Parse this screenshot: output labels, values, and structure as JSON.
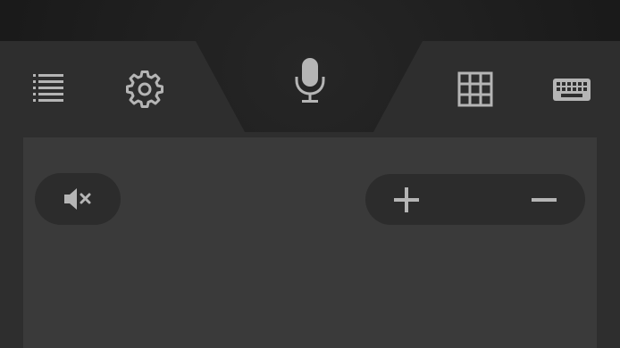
{
  "colors": {
    "background": "#1b1b1b",
    "toolbar": "#2e2e2e",
    "pad": "#3a3a3a",
    "pill": "#2c2c2c",
    "icon": "#b5b5b5"
  },
  "toolbar": {
    "left_icons": [
      "list-icon",
      "gear-icon"
    ],
    "center_icon": "microphone-icon",
    "right_icons": [
      "grid-icon",
      "keyboard-icon"
    ]
  },
  "pad": {
    "mute_icon": "volume-mute-icon",
    "volume_controls": [
      "plus-icon",
      "minus-icon"
    ]
  }
}
